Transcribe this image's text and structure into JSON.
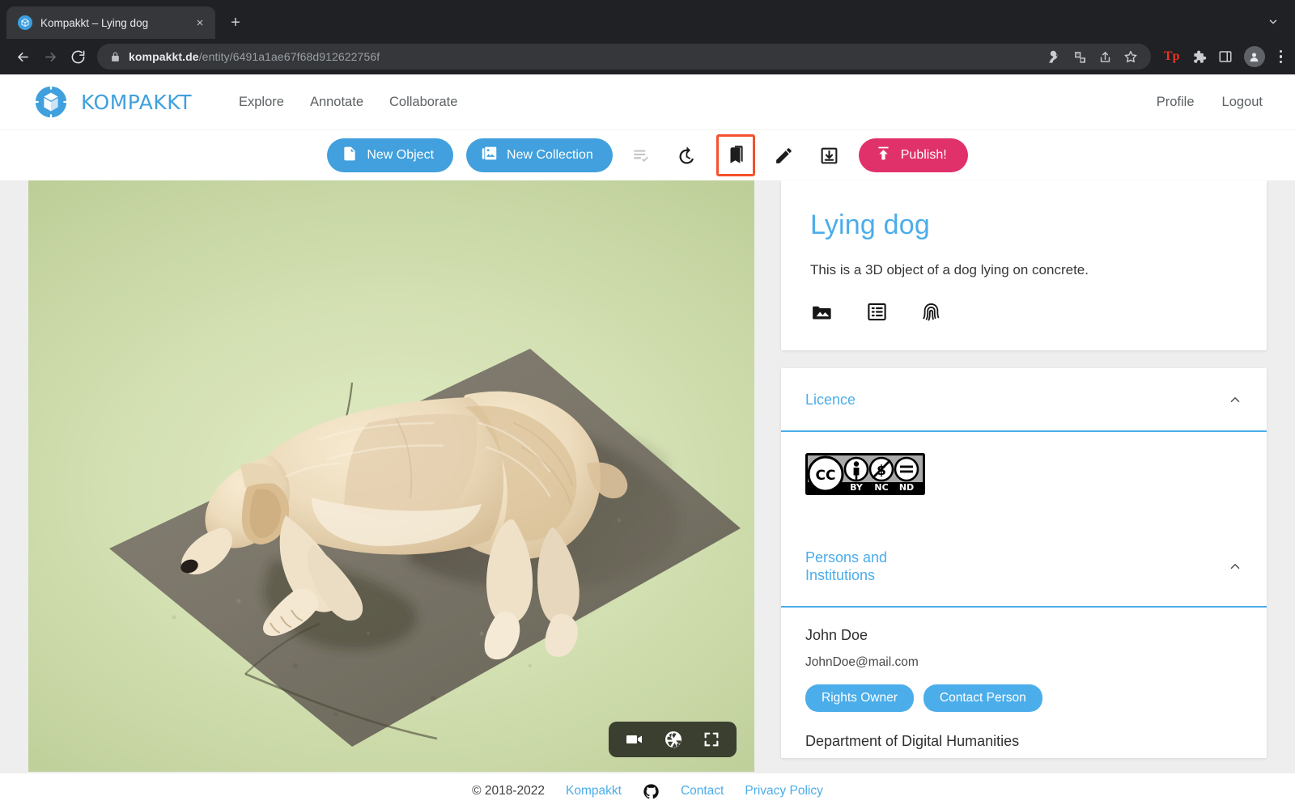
{
  "browser": {
    "tab": {
      "title": "Kompakkt – Lying dog",
      "favicon": "kompakkt-cube-icon",
      "close": "×"
    },
    "new_tab_label": "+",
    "url_domain": "kompakkt.de",
    "url_path": "/entity/6491a1ae67f68d912622756f",
    "toolbar_icons": [
      "back-arrow-icon",
      "forward-arrow-icon",
      "reload-icon",
      "lock-icon",
      "password-key-icon",
      "translate-icon",
      "share-icon",
      "bookmark-star-icon",
      "tp-extension-icon",
      "extensions-puzzle-icon",
      "side-panel-icon",
      "profile-avatar-icon",
      "chrome-menu-icon"
    ],
    "extension_label": "Tp"
  },
  "header": {
    "brand": "KOMPAKKT",
    "nav": [
      {
        "label": "Explore"
      },
      {
        "label": "Annotate"
      },
      {
        "label": "Collaborate"
      }
    ],
    "right": [
      {
        "label": "Profile"
      },
      {
        "label": "Logout"
      }
    ]
  },
  "actionbar": {
    "new_object": "New Object",
    "new_collection": "New Collection",
    "publish": "Publish!",
    "icons": [
      {
        "name": "playlist-check-icon",
        "state": "disabled"
      },
      {
        "name": "history-icon",
        "state": "enabled"
      },
      {
        "name": "bookmarks-icon",
        "state": "highlighted"
      },
      {
        "name": "edit-pencil-icon",
        "state": "enabled"
      },
      {
        "name": "download-icon",
        "state": "enabled"
      }
    ]
  },
  "viewer": {
    "scene": "3D model of a golden retriever dog lying on a square concrete slab, soft green gradient backdrop",
    "controls": [
      {
        "name": "video-camera-icon"
      },
      {
        "name": "camera-aperture-icon"
      },
      {
        "name": "fullscreen-icon"
      }
    ]
  },
  "object": {
    "title": "Lying dog",
    "description": "This is a 3D object of a dog lying on concrete.",
    "icons": [
      {
        "name": "image-collection-icon"
      },
      {
        "name": "list-details-icon"
      },
      {
        "name": "fingerprint-icon"
      }
    ]
  },
  "licence": {
    "title": "Licence",
    "expanded": true,
    "badge": {
      "name": "creative-commons-by-nc-nd-badge",
      "cc": "CC",
      "terms": [
        "BY",
        "NC",
        "ND"
      ]
    }
  },
  "persons": {
    "title": "Persons and Institutions",
    "title_line1": "Persons and",
    "title_line2": "Institutions",
    "expanded": true,
    "person": {
      "name": "John Doe",
      "email": "JohnDoe@mail.com",
      "roles": [
        "Rights Owner",
        "Contact Person"
      ]
    },
    "institution": "Department of Digital Humanities"
  },
  "footer": {
    "copyright": "© 2018-2022",
    "brand_link": "Kompakkt",
    "github_icon": "github-icon",
    "links": [
      {
        "label": "Contact"
      },
      {
        "label": "Privacy Policy"
      }
    ]
  },
  "colors": {
    "accent_blue": "#4badea",
    "publish_pink": "#e0316a",
    "highlight_red": "#f4512c",
    "page_bg": "#eeeeee",
    "chrome_bg": "#202124"
  }
}
